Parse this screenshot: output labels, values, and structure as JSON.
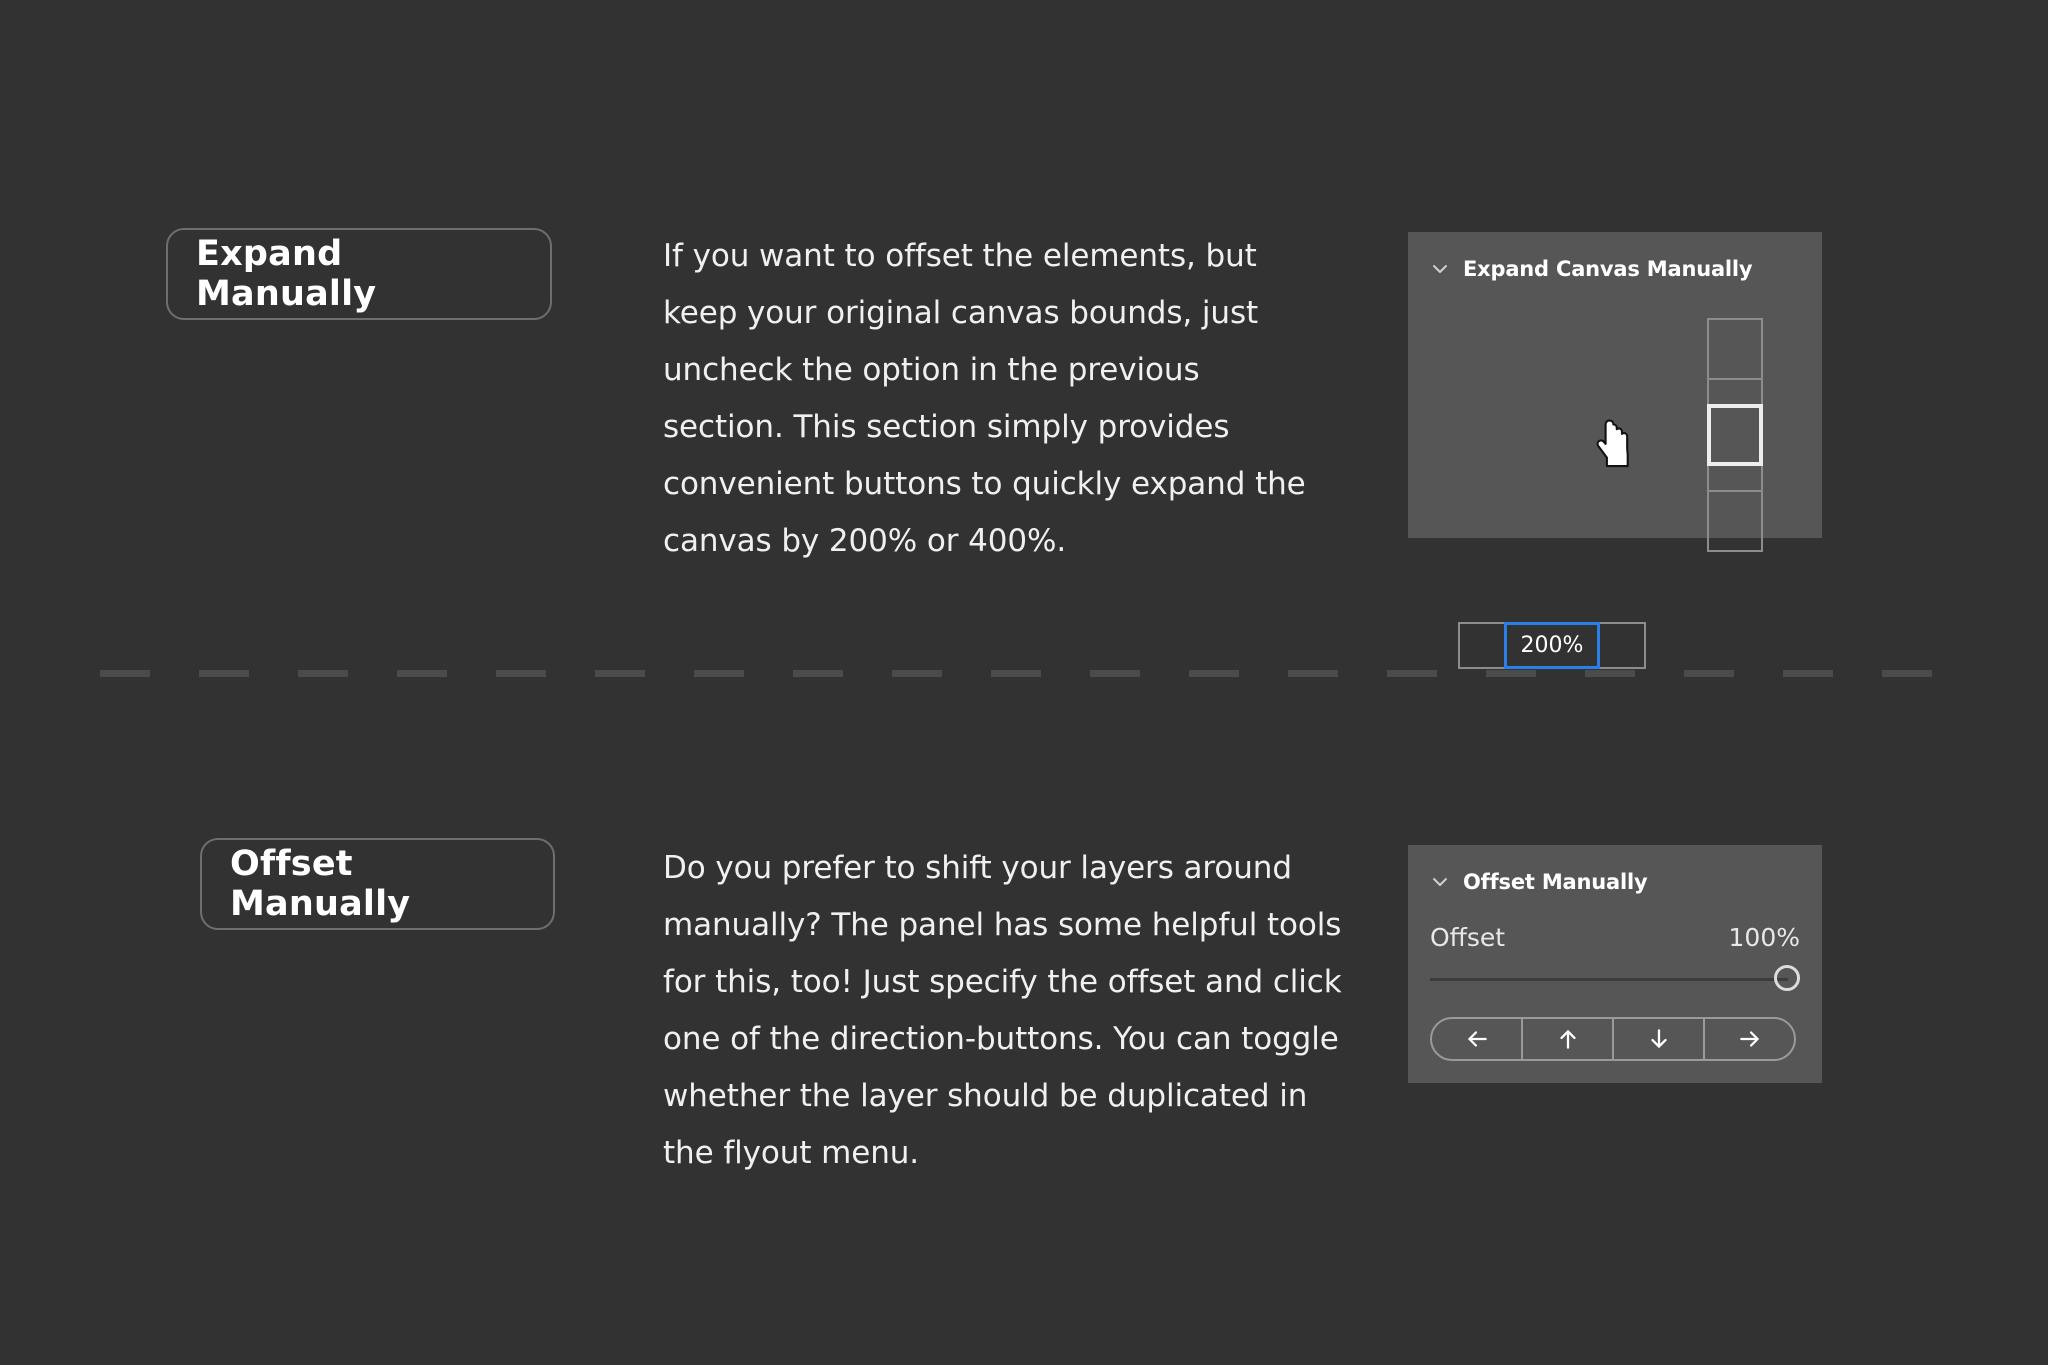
{
  "theme": {
    "page_background": "#323232",
    "panel_background": "#565656",
    "accent_blue": "#2a7fe8",
    "text_primary": "#f0f0f0",
    "border_gray": "#8c8c8c"
  },
  "sections": [
    {
      "id": "expand-manually",
      "heading_button": "Expand Manually",
      "body": "If you want to offset the elements, but keep your original canvas bounds, just uncheck the option in the previous section. This section simply provides convenient buttons to quickly expand the canvas by 200% or 400%.",
      "panel": {
        "title": "Expand Canvas Manually",
        "collapse_icon": "chevron-down-icon",
        "segmented_buttons": [
          {
            "label": "",
            "active": false
          },
          {
            "label": "200%",
            "active": true
          },
          {
            "label": "",
            "active": false
          }
        ],
        "vertical_boxes": [
          {
            "size": "tall",
            "active": false
          },
          {
            "size": "short",
            "active": false
          },
          {
            "size": "tall",
            "active": true
          },
          {
            "size": "short",
            "active": false
          },
          {
            "size": "tall",
            "active": false
          }
        ],
        "cursor": "pointing-hand-cursor"
      }
    },
    {
      "id": "offset-manually",
      "heading_button": "Offset Manually",
      "body": "Do you prefer to shift your layers around manually? The panel has some helpful tools for this, too! Just specify the offset and click one of the direction-buttons. You can toggle whether the layer should be duplicated in the flyout menu.",
      "panel": {
        "title": "Offset Manually",
        "collapse_icon": "chevron-down-icon",
        "offset_label": "Offset",
        "offset_value": "100%",
        "slider_position_percent": 100,
        "direction_buttons": [
          {
            "name": "offset-left-button",
            "icon": "arrow-left-icon"
          },
          {
            "name": "offset-up-button",
            "icon": "arrow-up-icon"
          },
          {
            "name": "offset-down-button",
            "icon": "arrow-down-icon"
          },
          {
            "name": "offset-right-button",
            "icon": "arrow-right-icon"
          }
        ]
      }
    }
  ]
}
